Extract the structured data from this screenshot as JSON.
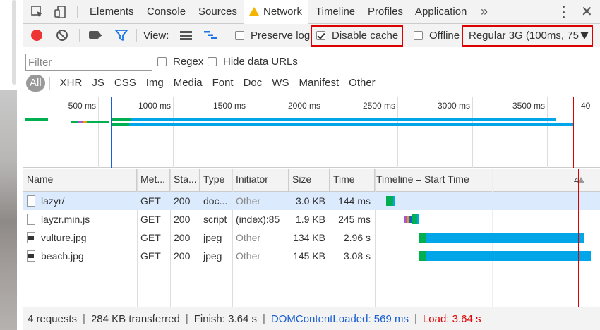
{
  "tabs": {
    "items": [
      "Elements",
      "Console",
      "Sources",
      "Network",
      "Timeline",
      "Profiles",
      "Application"
    ],
    "more": "»"
  },
  "toolbar": {
    "view_label": "View:",
    "preserve_log": "Preserve log",
    "disable_cache": "Disable cache",
    "offline": "Offline",
    "throttling": "Regular 3G (100ms, 75"
  },
  "filter": {
    "placeholder": "Filter",
    "regex": "Regex",
    "hide_data_urls": "Hide data URLs",
    "types": [
      "All",
      "XHR",
      "JS",
      "CSS",
      "Img",
      "Media",
      "Font",
      "Doc",
      "WS",
      "Manifest",
      "Other"
    ]
  },
  "overview": {
    "ticks": [
      "500 ms",
      "1000 ms",
      "1500 ms",
      "2000 ms",
      "2500 ms",
      "3000 ms",
      "3500 ms",
      "40"
    ]
  },
  "table": {
    "headers": [
      "Name",
      "Met...",
      "Sta...",
      "Type",
      "Initiator",
      "Size",
      "Time",
      "Timeline – Start Time"
    ],
    "waterfall_marker": "4",
    "rows": [
      {
        "name": "lazyr/",
        "method": "GET",
        "status": "200",
        "type": "doc...",
        "initiator": "Other",
        "size": "3.0 KB",
        "time": "144 ms",
        "icon": "document-icon"
      },
      {
        "name": "layzr.min.js",
        "method": "GET",
        "status": "200",
        "type": "script",
        "initiator": "(index):85",
        "size": "1.9 KB",
        "time": "245 ms",
        "icon": "document-icon"
      },
      {
        "name": "vulture.jpg",
        "method": "GET",
        "status": "200",
        "type": "jpeg",
        "initiator": "Other",
        "size": "134 KB",
        "time": "2.96 s",
        "icon": "image-icon"
      },
      {
        "name": "beach.jpg",
        "method": "GET",
        "status": "200",
        "type": "jpeg",
        "initiator": "Other",
        "size": "145 KB",
        "time": "3.08 s",
        "icon": "image-icon"
      }
    ]
  },
  "status": {
    "requests": "4 requests",
    "transferred": "284 KB transferred",
    "finish": "Finish: 3.64 s",
    "dom_content_loaded": "DOMContentLoaded: 569 ms",
    "load": "Load: 3.64 s"
  },
  "colors": {
    "record": "#ee3333",
    "dom_content_loaded": "#1a5fd0",
    "load": "#dd0000",
    "waiting": "#00b050",
    "download": "#00a6e8",
    "highlight_box": "#dd0000"
  }
}
